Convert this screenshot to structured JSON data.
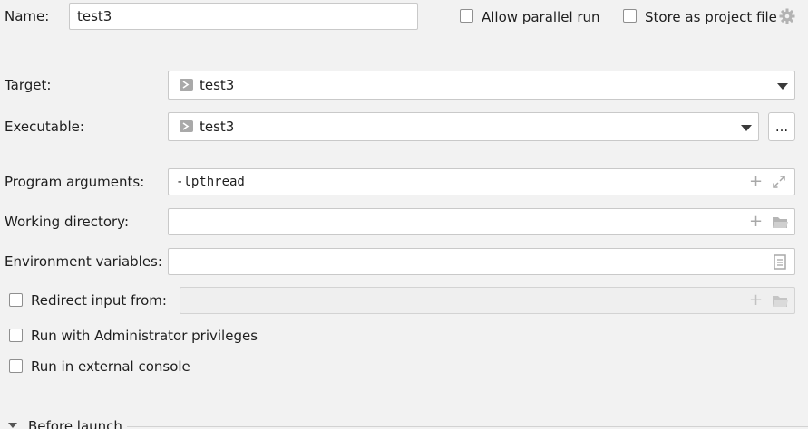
{
  "name_row": {
    "label": "Name:",
    "value": "test3",
    "allow_parallel_label": "Allow parallel run",
    "store_project_label": "Store as project file"
  },
  "target": {
    "label": "Target:",
    "value": "test3"
  },
  "executable": {
    "label": "Executable:",
    "value": "test3",
    "browse_label": "..."
  },
  "program_args": {
    "label": "Program arguments:",
    "value": "-lpthread"
  },
  "working_dir": {
    "label": "Working directory:",
    "value": ""
  },
  "env_vars": {
    "label": "Environment variables:",
    "value": ""
  },
  "redirect": {
    "label": "Redirect input from:",
    "value": ""
  },
  "admin": {
    "label": "Run with Administrator privileges"
  },
  "external_console": {
    "label": "Run in external console"
  },
  "before_launch": {
    "label": "Before launch"
  },
  "icons": [
    "run-config-icon",
    "gear-icon",
    "plus-icon",
    "expand-icon",
    "folder-icon",
    "document-icon",
    "chevron-down-icon"
  ]
}
